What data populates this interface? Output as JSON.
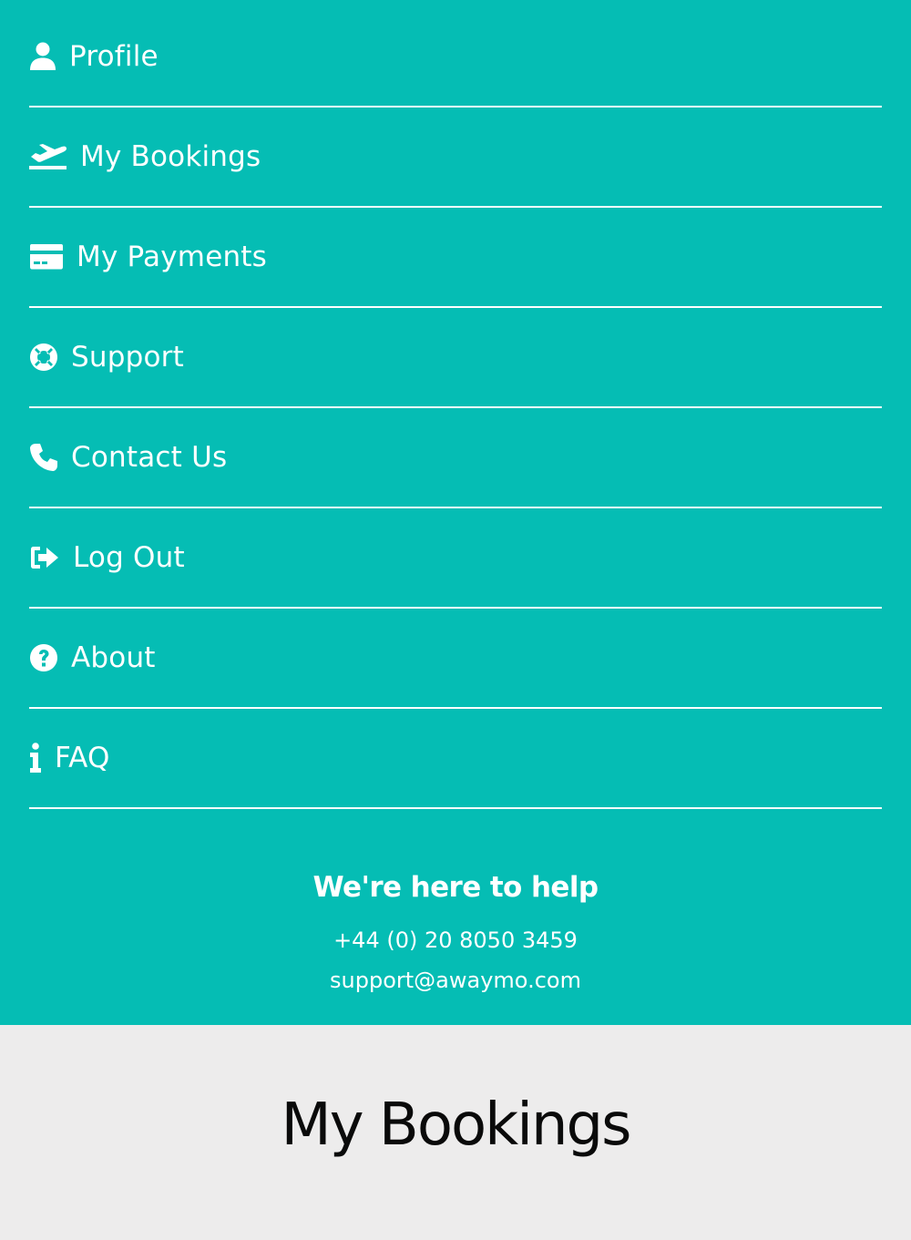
{
  "menu": {
    "items": [
      {
        "label": "Profile",
        "icon": "user-icon"
      },
      {
        "label": "My Bookings",
        "icon": "plane-departure-icon"
      },
      {
        "label": "My Payments",
        "icon": "credit-card-icon"
      },
      {
        "label": "Support",
        "icon": "life-ring-icon"
      },
      {
        "label": "Contact Us",
        "icon": "phone-icon"
      },
      {
        "label": "Log Out",
        "icon": "sign-out-icon"
      },
      {
        "label": "About",
        "icon": "question-circle-icon"
      },
      {
        "label": "FAQ",
        "icon": "info-icon"
      }
    ]
  },
  "help": {
    "title": "We're here to help",
    "phone": "+44 (0) 20 8050 3459",
    "email": "support@awaymo.com"
  },
  "page": {
    "title": "My Bookings"
  },
  "colors": {
    "menu_background": "#05bdb4",
    "page_background": "#edecec",
    "menu_text": "#ffffff",
    "title_text": "#0a0a0a"
  }
}
